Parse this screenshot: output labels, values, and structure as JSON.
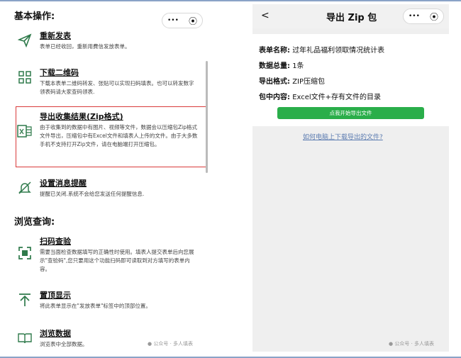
{
  "left": {
    "section1_title": "基本操作:",
    "menu_icons": "•••",
    "items1": [
      {
        "title": "重新发表",
        "desc": "表单已经收回，重新用費信发放表单。"
      },
      {
        "title": "下载二维码",
        "desc": "下载本表单二维码转发、张贴可以实现扫码填表。也可以转发数字领表码请大家查码领表."
      },
      {
        "title": "导出收集结果(Zip格式)",
        "desc": "由于收集到的数据中有图片、视频等文件，数据会以压缩包Zip格式文件导出，压缩包中有Excel文件和填表人上传的文件。由于大多数手机不支持打开Zip文件，请在电脑端打开压缩包。"
      },
      {
        "title": "设置消息提醒",
        "desc": "提醒已关闭.系统不会给您发送任何提醒信息."
      }
    ],
    "section2_title": "浏览查询:",
    "items2": [
      {
        "title": "扫码查验",
        "desc": "需要当面检查数据填写的正确性时使用。填表人提交表单后向您展示\"查验码\",您只要用这个功能扫码即可读取到对方填写的表单内容。"
      },
      {
        "title": "置顶显示",
        "desc": "将此表单显示在\"发放表单\"标签中的顶部位置。"
      },
      {
        "title": "浏览数据",
        "desc": "浏览表中全部数据。"
      }
    ],
    "watermark": "公众号 · 多人填表"
  },
  "right": {
    "back": "<",
    "title": "导出 Zip 包",
    "menu_icons": "•••",
    "rows": [
      {
        "label": "表单名称:",
        "value": "过年礼品福利领取情况统计表"
      },
      {
        "label": "数据总量:",
        "value": "1条"
      },
      {
        "label": "导出格式:",
        "value": "ZIP压缩包"
      },
      {
        "label": "包中内容:",
        "value": "Excel文件+存有文件的目录"
      }
    ],
    "button": "点我开始导出文件",
    "link": "如何电脑上下载导出的文件?",
    "watermark": "公众号 · 多人填表"
  },
  "colors": {
    "accent_green": "#2aae4a",
    "highlight_red": "#d93a3a",
    "link_blue": "#5b7bb0",
    "icon_green": "#2f7a4b"
  }
}
